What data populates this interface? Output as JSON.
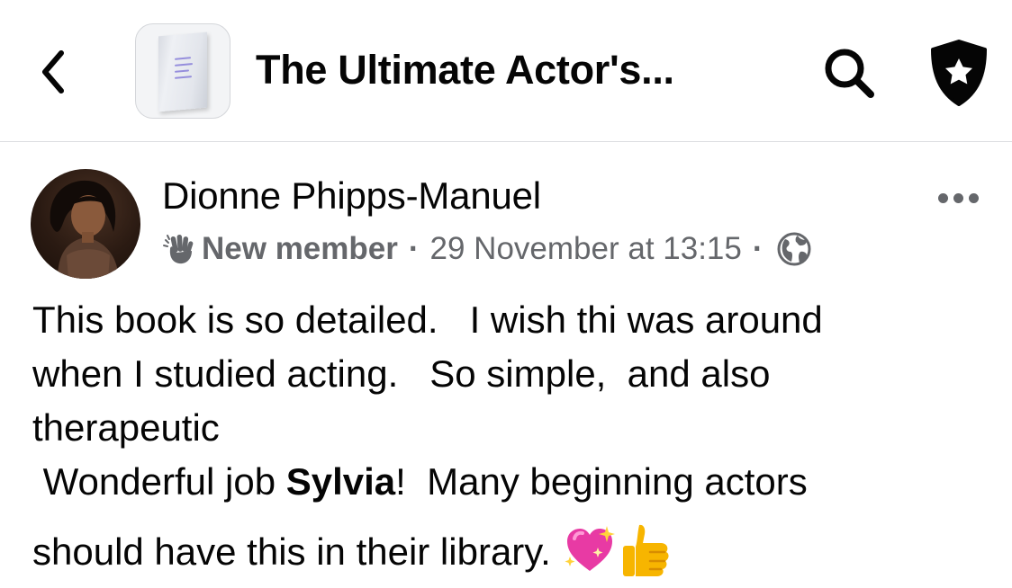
{
  "header": {
    "title": "The Ultimate Actor's...",
    "thumbnail_icon": "book-cover",
    "back_icon": "chevron-left-icon",
    "search_icon": "search-icon",
    "admin_icon": "shield-star-icon"
  },
  "post": {
    "author": "Dionne Phipps-Manuel",
    "badge": "New member",
    "timestamp": "29 November at 13:15",
    "privacy_icon": "globe-icon",
    "text_lines": [
      "This book is so detailed.   I wish thi was around",
      "when I studied acting.   So simple,  and also",
      "therapeutic"
    ],
    "line4_prefix": " Wonderful job ",
    "line4_mention": "Sylvia",
    "line4_suffix": "!  Many beginning actors",
    "line5": "should have this in their library. ",
    "emojis": [
      "sparkling-heart",
      "thumbs-up"
    ]
  },
  "colors": {
    "text": "#050505",
    "secondary": "#65676b",
    "divider": "#dcdde0"
  }
}
